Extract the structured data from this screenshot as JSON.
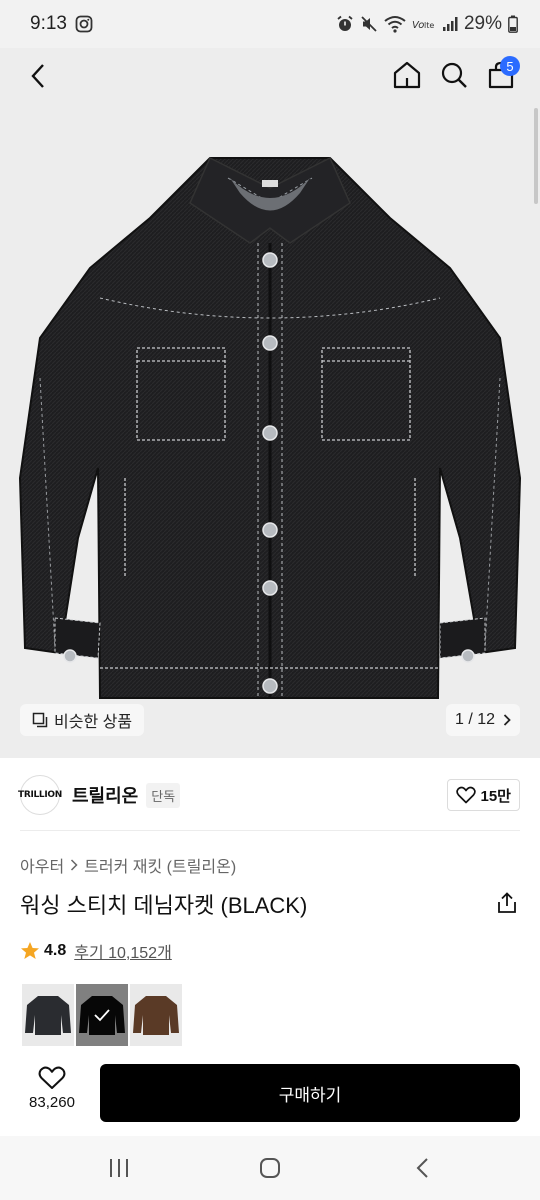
{
  "status_bar": {
    "time": "9:13",
    "battery": "29%",
    "icons": [
      "instagram-icon",
      "alarm-icon",
      "mute-icon",
      "wifi-icon",
      "volte-icon",
      "signal-icon",
      "battery-icon"
    ]
  },
  "top_nav": {
    "cart_count": "5",
    "icons": [
      "back-icon",
      "home-icon",
      "search-icon",
      "shopping-bag-icon"
    ],
    "badge_color": "#2b6bff"
  },
  "gallery": {
    "similar_label": "비슷한 상품",
    "page_indicator": "1 / 12"
  },
  "brand": {
    "logo_text": "TRILLION",
    "name": "트릴리온",
    "badge": "단독",
    "like_count": "15만"
  },
  "product": {
    "breadcrumb": [
      "아우터",
      "트러커 재킷 (트릴리온)"
    ],
    "title": "워싱 스티치 데님자켓 (BLACK)",
    "rating": "4.8",
    "review_link": "후기 10,152개",
    "star_color": "#f5a623"
  },
  "swatches": [
    {
      "color": "#2a2c30",
      "selected": false
    },
    {
      "color": "#0d0d0d",
      "selected": true
    },
    {
      "color": "#5a3a26",
      "selected": false
    }
  ],
  "bottom_bar": {
    "wish_count": "83,260",
    "buy_label": "구매하기"
  },
  "system_nav": [
    "recent-apps-icon",
    "home-button-icon",
    "back-button-icon"
  ]
}
